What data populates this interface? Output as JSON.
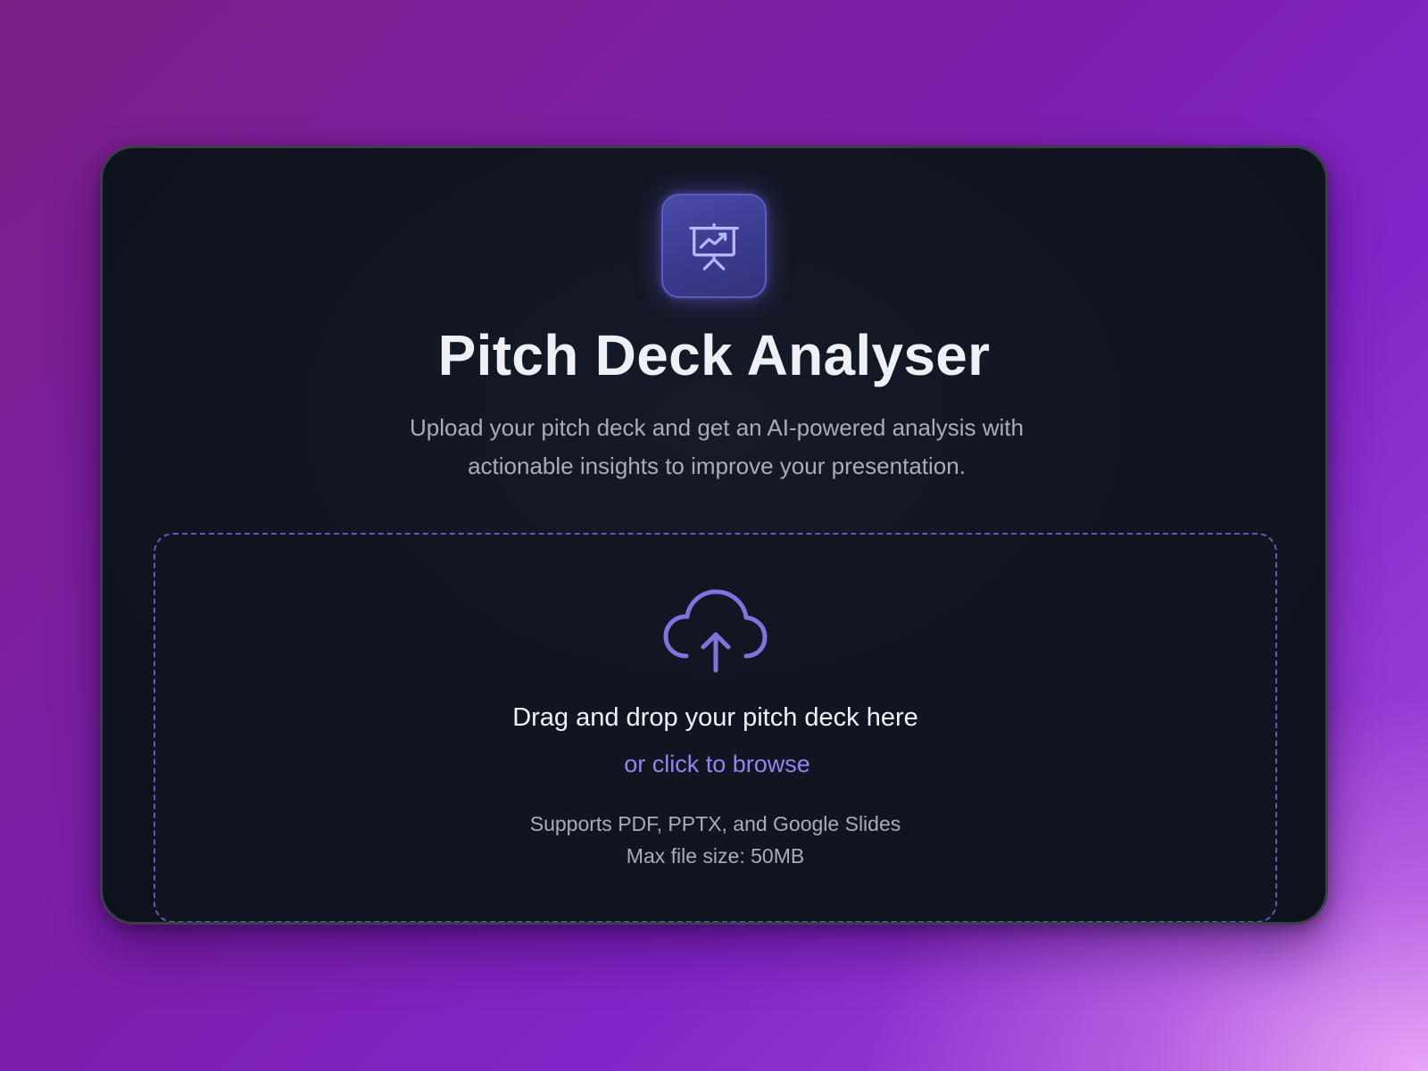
{
  "app": {
    "title": "Pitch Deck Analyser",
    "subtitle": "Upload your pitch deck and get an AI-powered analysis with actionable insights to improve your presentation.",
    "logo_icon": "presentation-chart-icon"
  },
  "upload": {
    "icon": "cloud-upload-icon",
    "prompt": "Drag and drop your pitch deck here",
    "browse_label": "or click to browse",
    "supported_formats": "Supports PDF, PPTX, and Google Slides",
    "max_file_size": "Max file size: 50MB"
  },
  "colors": {
    "accent": "#8f86f0",
    "card_background": "#111521",
    "logo_background": "#3f3d95",
    "dropzone_border": "#5f5ab8"
  }
}
